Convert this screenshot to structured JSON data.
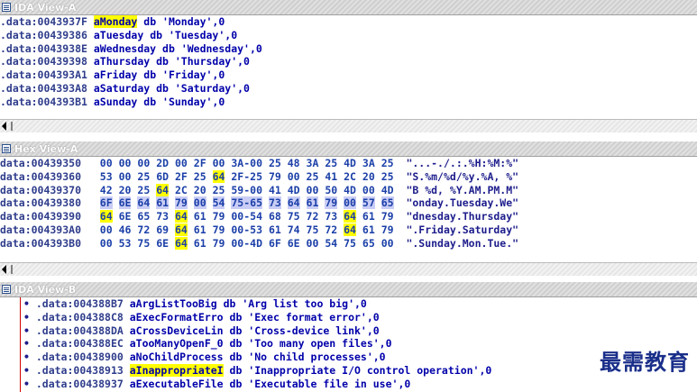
{
  "paneA": {
    "title": "IDA View-A",
    "lines": [
      {
        "addr": ".data:0043937F",
        "label": "aMonday",
        "rest": " db 'Monday',0",
        "hl": true
      },
      {
        "addr": ".data:00439386",
        "label": "aTuesday",
        "rest": " db 'Tuesday',0"
      },
      {
        "addr": ".data:0043938E",
        "label": "aWednesday",
        "rest": " db 'Wednesday',0"
      },
      {
        "addr": ".data:00439398",
        "label": "aThursday",
        "rest": " db 'Thursday',0"
      },
      {
        "addr": ".data:004393A1",
        "label": "aFriday",
        "rest": " db 'Friday',0"
      },
      {
        "addr": ".data:004393A8",
        "label": "aSaturday",
        "rest": " db 'Saturday',0"
      },
      {
        "addr": ".data:004393B1",
        "label": "aSunday",
        "rest": " db 'Sunday',0"
      }
    ]
  },
  "paneHex": {
    "title": "Hex View-A",
    "rows": [
      {
        "addr": "data:00439350",
        "bytes": [
          "00",
          "00",
          "00",
          "2D",
          "00",
          "2F",
          "00",
          "3A-00",
          "25",
          "48",
          "3A",
          "25",
          "4D",
          "3A",
          "25"
        ],
        "ascii": "\"...-./.:.%H:%M:%\""
      },
      {
        "addr": "data:00439360",
        "bytes": [
          "53",
          "00",
          "25",
          "6D",
          "2F",
          "25",
          "64",
          "2F-25",
          "79",
          "00",
          "25",
          "41",
          "2C",
          "20",
          "25"
        ],
        "ascii": "\"S.%m/%d/%y.%A, %\""
      },
      {
        "addr": "data:00439370",
        "bytes": [
          "42",
          "20",
          "25",
          "64",
          "2C",
          "20",
          "25",
          "59-00",
          "41",
          "4D",
          "00",
          "50",
          "4D",
          "00",
          "4D"
        ],
        "ascii": "\"B %d, %Y.AM.PM.M\""
      },
      {
        "addr": "data:00439380",
        "bytes": [
          "6F",
          "6E",
          "64",
          "61",
          "79",
          "00",
          "54",
          "75-65",
          "73",
          "64",
          "61",
          "79",
          "00",
          "57",
          "65"
        ],
        "ascii": "\"onday.Tuesday.We\""
      },
      {
        "addr": "data:00439390",
        "bytes": [
          "64",
          "6E",
          "65",
          "73",
          "64",
          "61",
          "79",
          "00-54",
          "68",
          "75",
          "72",
          "73",
          "64",
          "61",
          "79"
        ],
        "ascii": "\"dnesday.Thursday\""
      },
      {
        "addr": "data:004393A0",
        "bytes": [
          "00",
          "46",
          "72",
          "69",
          "64",
          "61",
          "79",
          "00-53",
          "61",
          "74",
          "75",
          "72",
          "64",
          "61",
          "79"
        ],
        "ascii": "\".Friday.Saturday\""
      },
      {
        "addr": "data:004393B0",
        "bytes": [
          "00",
          "53",
          "75",
          "6E",
          "64",
          "61",
          "79",
          "00-4D",
          "6F",
          "6E",
          "00",
          "54",
          "75",
          "65",
          "00"
        ],
        "ascii": "\".Sunday.Mon.Tue.\""
      }
    ]
  },
  "paneB": {
    "title": "IDA View-B",
    "lines": [
      {
        "addr": ".data:004388B7",
        "label": "aArgListTooBig",
        "rest": " db 'Arg list too big',0"
      },
      {
        "addr": ".data:004388C8",
        "label": "aExecFormatErro",
        "rest": " db 'Exec format error',0"
      },
      {
        "addr": ".data:004388DA",
        "label": "aCrossDeviceLin",
        "rest": " db 'Cross-device link',0"
      },
      {
        "addr": ".data:004388EC",
        "label": "aTooManyOpenF_0",
        "rest": " db 'Too many open files',0"
      },
      {
        "addr": ".data:00438900",
        "label": "aNoChildProcess",
        "rest": " db 'No child processes',0"
      },
      {
        "addr": ".data:00438913",
        "label": "aInappropriateI",
        "rest": " db 'Inappropriate I/O control operation',0",
        "hl": true
      },
      {
        "addr": ".data:00438937",
        "label": "aExecutableFile",
        "rest": " db 'Executable file in use',0"
      }
    ]
  },
  "watermark": "最需教育"
}
